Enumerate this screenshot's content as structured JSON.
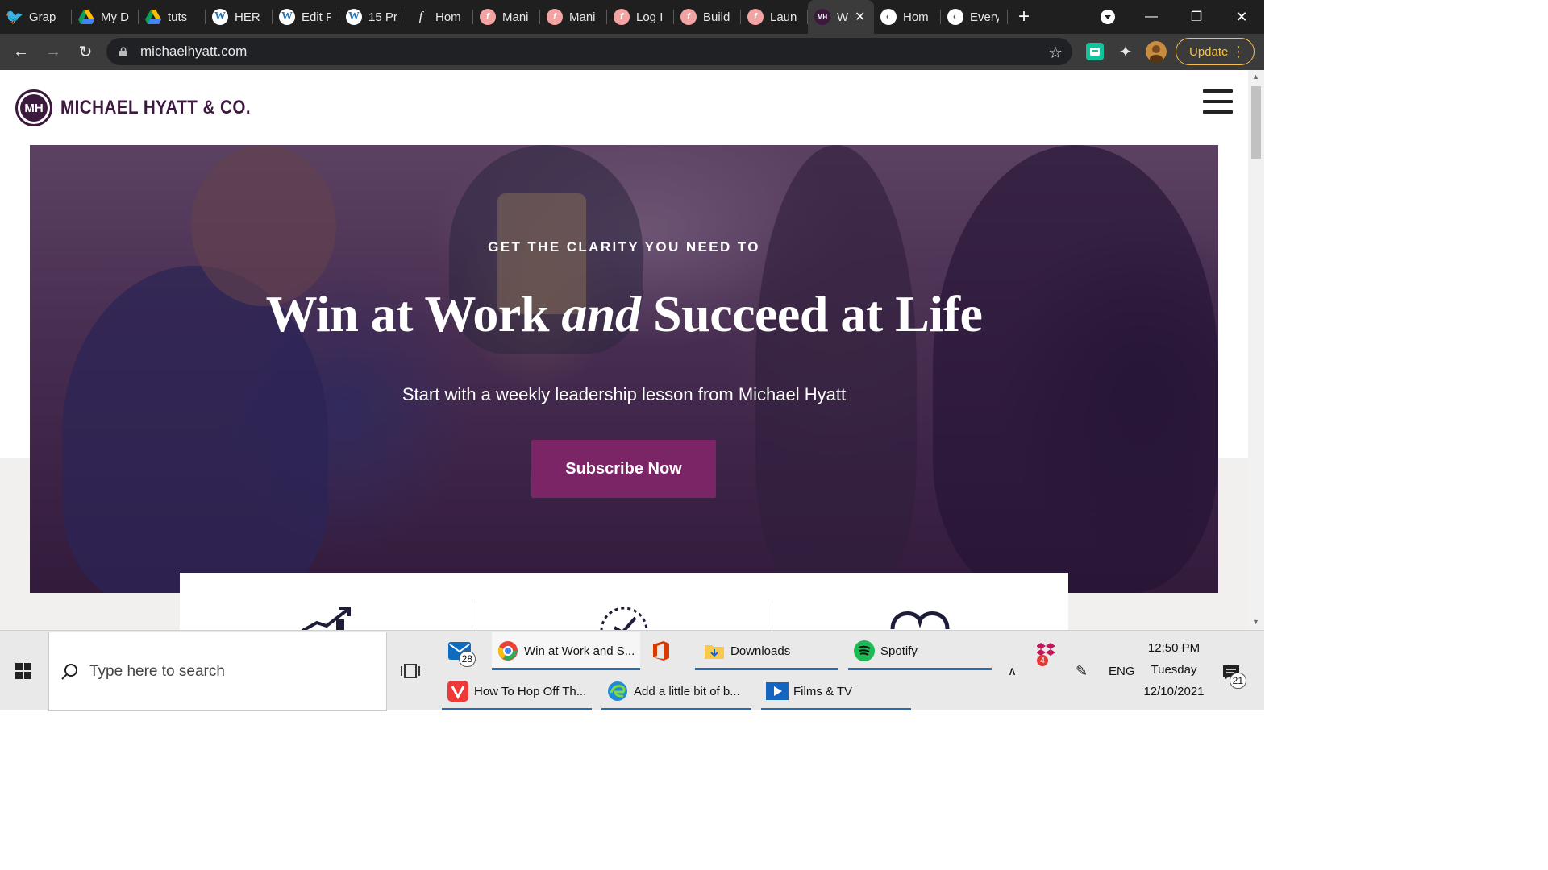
{
  "browser": {
    "tabs": [
      {
        "label": "Grap",
        "icon": "twitter-icon",
        "color": "#1da1f2"
      },
      {
        "label": "My D",
        "icon": "google-drive-icon",
        "color": "#fbbc04"
      },
      {
        "label": "tuts",
        "icon": "google-drive-icon",
        "color": "#fbbc04"
      },
      {
        "label": "HER",
        "icon": "wordpress-icon",
        "color": "#2271b1"
      },
      {
        "label": "Edit F",
        "icon": "wordpress-icon",
        "color": "#2271b1"
      },
      {
        "label": "15 Pr",
        "icon": "wordpress-icon",
        "color": "#2271b1"
      },
      {
        "label": "Hom",
        "icon": "script-f-icon",
        "color": "#1f1f1f"
      },
      {
        "label": "Mani",
        "icon": "circle-f-icon",
        "color": "#f4a3a3"
      },
      {
        "label": "Mani",
        "icon": "circle-f-icon",
        "color": "#f4a3a3"
      },
      {
        "label": "Log I",
        "icon": "circle-f-icon",
        "color": "#f4a3a3"
      },
      {
        "label": "Build",
        "icon": "circle-f-icon",
        "color": "#f4a3a3"
      },
      {
        "label": "Laun",
        "icon": "circle-f-icon",
        "color": "#f4a3a3"
      },
      {
        "label": "W",
        "icon": "mh-icon",
        "color": "#3c1a3e",
        "active": true
      },
      {
        "label": "Hom",
        "icon": "circle-swirl-icon",
        "color": "#ffffff"
      },
      {
        "label": "Every",
        "icon": "circle-swirl-icon",
        "color": "#ffffff"
      }
    ],
    "url": "michaelhyatt.com",
    "update_label": "Update"
  },
  "site": {
    "logo_initials": "MH",
    "logo_text": "MICHAEL HYATT & CO.",
    "hero": {
      "eyebrow": "GET THE CLARITY YOU NEED TO",
      "headline_part1": "Win at Work",
      "headline_italic": "and",
      "headline_part2": "Succeed at Life",
      "subhead": "Start with a weekly leadership lesson from Michael Hyatt",
      "cta_label": "Subscribe Now"
    },
    "colors": {
      "brand": "#3c1a3e",
      "cta": "#7b2466"
    }
  },
  "taskbar": {
    "search_placeholder": "Type here to search",
    "mail_badge": "28",
    "apps": [
      {
        "label": "Win at Work and S...",
        "icon": "chrome-icon"
      },
      {
        "label": "",
        "icon": "office-icon"
      },
      {
        "label": "Downloads",
        "icon": "folder-icon"
      },
      {
        "label": "Spotify",
        "icon": "spotify-icon"
      },
      {
        "label": "How To Hop Off Th...",
        "icon": "vivaldi-icon"
      },
      {
        "label": "Add a little bit of b...",
        "icon": "edge-icon"
      },
      {
        "label": "Films & TV",
        "icon": "films-tv-icon"
      }
    ],
    "dropbox_badge": "4",
    "language": "ENG",
    "time": "12:50 PM",
    "day": "Tuesday",
    "date": "12/10/2021",
    "notifications": "21"
  }
}
